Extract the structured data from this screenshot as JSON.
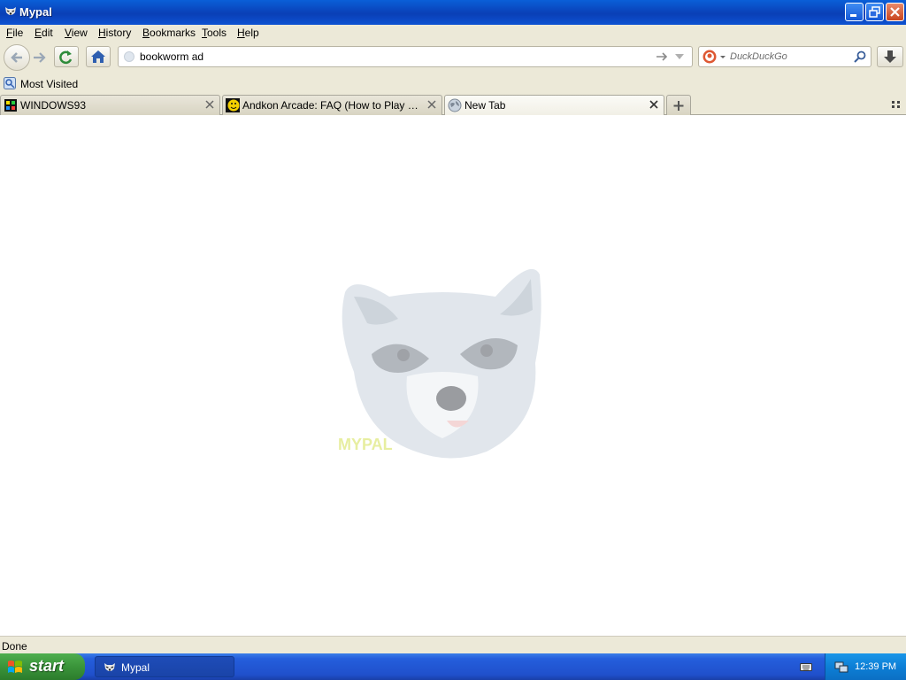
{
  "window": {
    "title": "Mypal"
  },
  "menu": {
    "items": [
      {
        "label": "File",
        "u": "F",
        "rest": "ile"
      },
      {
        "label": "Edit",
        "u": "E",
        "rest": "dit"
      },
      {
        "label": "View",
        "u": "V",
        "rest": "iew"
      },
      {
        "label": "History",
        "u": "H",
        "rest": "istory"
      },
      {
        "label": "Bookmarks",
        "u": "B",
        "rest": "ookmarks"
      },
      {
        "label": "Tools",
        "u": "T",
        "rest": "ools"
      },
      {
        "label": "Help",
        "u": "H",
        "rest": "elp"
      }
    ]
  },
  "navbar": {
    "url_value": "bookworm ad",
    "search_placeholder": "DuckDuckGo"
  },
  "bookmarks": {
    "most_visited": "Most Visited"
  },
  "tabs": [
    {
      "label": "WINDOWS93",
      "active": false,
      "icon": "windows93-icon"
    },
    {
      "label": "Andkon Arcade: FAQ (How to Play Flash, ...",
      "active": false,
      "icon": "andkon-smiley-icon"
    },
    {
      "label": "New Tab",
      "active": true,
      "icon": "globe-icon"
    }
  ],
  "content": {
    "logo_text": "MYPAL"
  },
  "status": {
    "text": "Done"
  },
  "taskbar": {
    "start_label": "start",
    "task_label": "Mypal",
    "clock": "12:39 PM"
  },
  "colors": {
    "titlebar": "#0A3FB6",
    "taskbar": "#245EDC",
    "start": "#3A943A",
    "chrome": "#ECE9D8"
  }
}
